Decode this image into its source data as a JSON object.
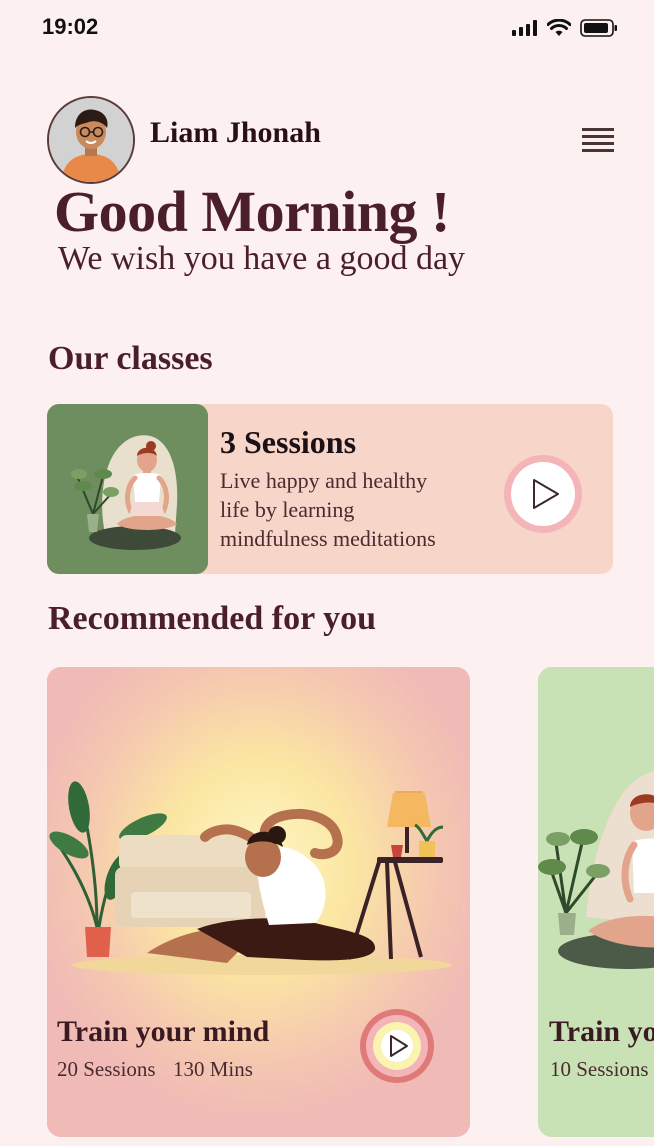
{
  "status": {
    "time": "19:02"
  },
  "user": {
    "name": "Liam Jhonah"
  },
  "greeting": {
    "title": "Good Morning !",
    "subtitle": "We wish you have a good day"
  },
  "classes": {
    "section_title": "Our classes",
    "card": {
      "sessions": "3 Sessions",
      "description_lines": [
        "Live happy and healthy",
        "life by learning",
        "mindfulness meditations"
      ]
    }
  },
  "recommended": {
    "section_title": "Recommended for you",
    "cards": [
      {
        "title": "Train your mind",
        "sessions": "20 Sessions",
        "duration": "130 Mins",
        "color": "#f0bab6"
      },
      {
        "title": "Train yo",
        "sessions": "10 Sessions",
        "color": "#c8e2b5"
      }
    ]
  },
  "colors": {
    "background": "#fcf0f0",
    "text": "#4a1f2a",
    "class_card": "#f7d5c8",
    "class_thumb": "#6f8e60",
    "play_ring": "#f4b5b8"
  },
  "icons": {
    "menu": "hamburger-icon",
    "play": "play-icon",
    "signal": "signal-icon",
    "wifi": "wifi-icon",
    "battery": "battery-icon"
  }
}
